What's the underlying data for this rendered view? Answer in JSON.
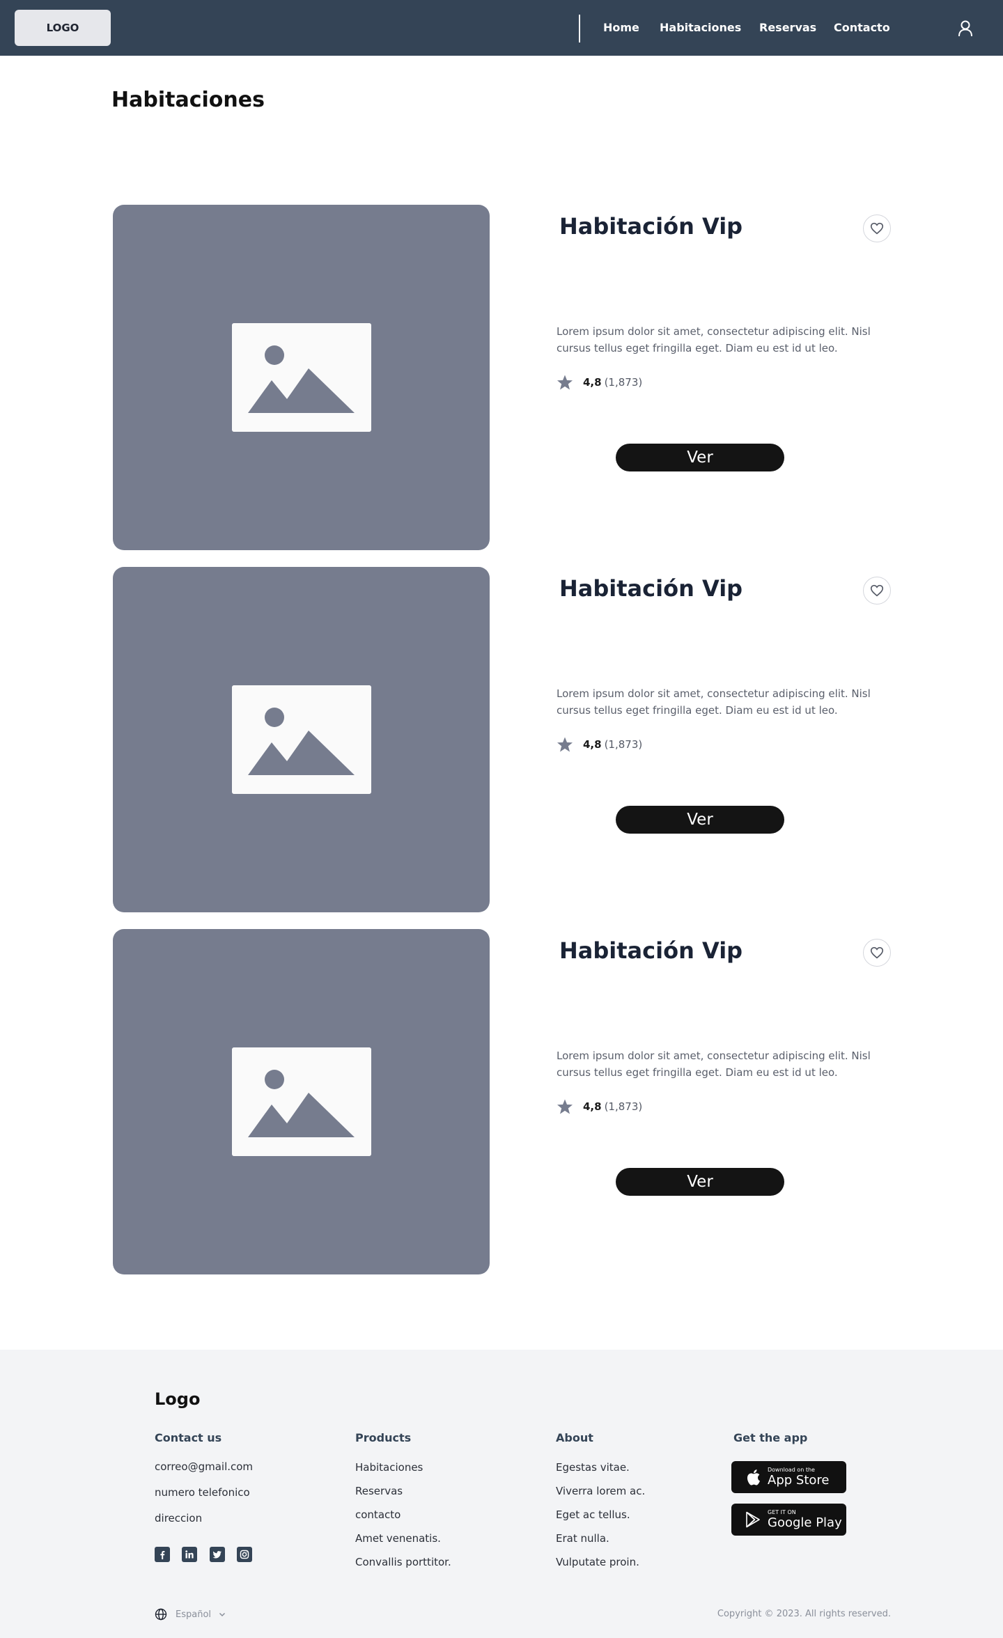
{
  "header": {
    "logo": "LOGO",
    "nav": [
      "Home",
      "Habitaciones",
      "Reservas",
      "Contacto"
    ]
  },
  "page_title": "Habitaciones",
  "rooms": [
    {
      "title": "Habitación Vip",
      "description": "Lorem ipsum dolor sit amet, consectetur adipiscing elit. Nisl cursus tellus eget fringilla eget. Diam eu est id ut leo.",
      "rating": "4,8",
      "reviews": "(1,873)",
      "button": "Ver"
    },
    {
      "title": "Habitación Vip",
      "description": "Lorem ipsum dolor sit amet, consectetur adipiscing elit. Nisl cursus tellus eget fringilla eget. Diam eu est id ut leo.",
      "rating": "4,8",
      "reviews": "(1,873)",
      "button": "Ver"
    },
    {
      "title": "Habitación Vip",
      "description": "Lorem ipsum dolor sit amet, consectetur adipiscing elit. Nisl cursus tellus eget fringilla eget. Diam eu est id ut leo.",
      "rating": "4,8",
      "reviews": "(1,873)",
      "button": "Ver"
    }
  ],
  "footer": {
    "logo": "Logo",
    "contact": {
      "title": "Contact us",
      "items": [
        "correo@gmail.com",
        "numero telefonico",
        "direccion"
      ]
    },
    "products": {
      "title": "Products",
      "items": [
        "Habitaciones",
        "Reservas",
        "contacto",
        "Amet venenatis.",
        "Convallis porttitor."
      ]
    },
    "about": {
      "title": "About",
      "items": [
        "Egestas vitae.",
        "Viverra lorem ac.",
        "Eget ac tellus.",
        "Erat nulla.",
        "Vulputate proin."
      ]
    },
    "app": {
      "title": "Get the app",
      "app_store_small": "Download on the",
      "app_store_big": "App Store",
      "google_play_small": "GET IT ON",
      "google_play_big": "Google Play"
    },
    "language": "Español",
    "copyright": "Copyright © 2023. All rights reserved."
  }
}
